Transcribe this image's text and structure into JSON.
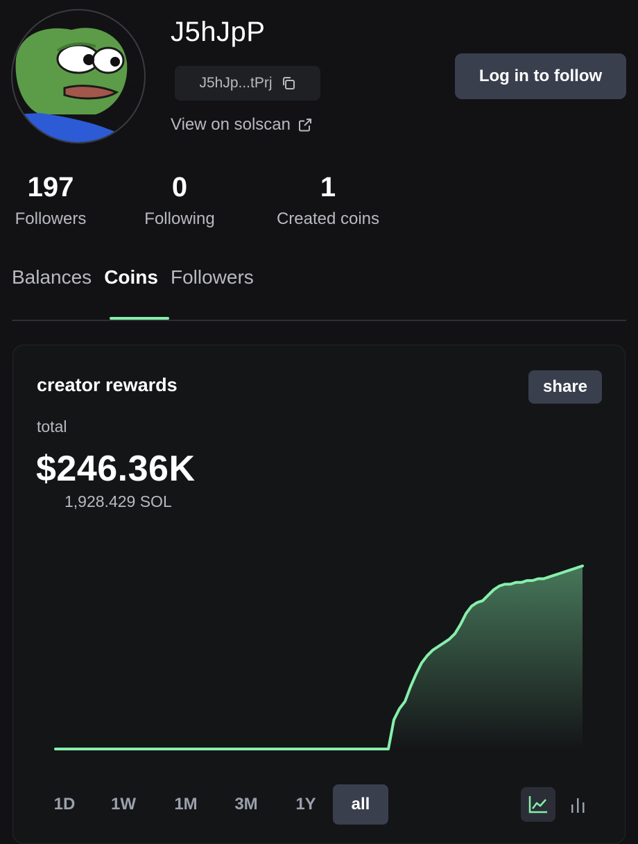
{
  "profile": {
    "username": "J5hJpP",
    "address_short": "J5hJp...tPrj",
    "solscan_label": "View on solscan",
    "follow_label": "Log in to follow"
  },
  "stats": [
    {
      "value": "197",
      "label": "Followers"
    },
    {
      "value": "0",
      "label": "Following"
    },
    {
      "value": "1",
      "label": "Created coins"
    }
  ],
  "tabs": [
    {
      "label": "Balances",
      "active": false
    },
    {
      "label": "Coins",
      "active": true
    },
    {
      "label": "Followers",
      "active": false
    }
  ],
  "card": {
    "title": "creator rewards",
    "share_label": "share",
    "total_label": "total",
    "total_value": "$246.36K",
    "total_sol": "1,928.429 SOL"
  },
  "ranges": [
    {
      "label": "1D",
      "active": false
    },
    {
      "label": "1W",
      "active": false
    },
    {
      "label": "1M",
      "active": false
    },
    {
      "label": "3M",
      "active": false
    },
    {
      "label": "1Y",
      "active": false
    },
    {
      "label": "all",
      "active": true
    }
  ],
  "view_toggle": [
    "line-chart-icon",
    "bar-chart-icon"
  ],
  "colors": {
    "background": "#121214",
    "accent_green": "#86efac",
    "button_bg": "#3a3f4e",
    "muted_text": "#b8bac0"
  },
  "chart_data": {
    "type": "area",
    "title": "creator rewards",
    "xlabel": "",
    "ylabel": "",
    "grid": false,
    "y_relative": [
      0.0,
      0.0,
      0.0,
      0.0,
      0.0,
      0.0,
      0.0,
      0.0,
      0.0,
      0.0,
      0.0,
      0.0,
      0.0,
      0.0,
      0.0,
      0.0,
      0.0,
      0.0,
      0.0,
      0.0,
      0.0,
      0.0,
      0.0,
      0.0,
      0.0,
      0.0,
      0.0,
      0.0,
      0.0,
      0.0,
      0.0,
      0.0,
      0.0,
      0.0,
      0.0,
      0.0,
      0.0,
      0.0,
      0.0,
      0.0,
      0.0,
      0.0,
      0.0,
      0.0,
      0.0,
      0.0,
      0.0,
      0.0,
      0.0,
      0.0,
      0.0,
      0.0,
      0.0,
      0.0,
      0.0,
      0.0,
      0.0,
      0.0,
      0.0,
      0.0,
      0.0,
      0.16,
      0.22,
      0.26,
      0.34,
      0.41,
      0.47,
      0.51,
      0.54,
      0.56,
      0.58,
      0.6,
      0.63,
      0.68,
      0.74,
      0.78,
      0.8,
      0.81,
      0.84,
      0.87,
      0.89,
      0.9,
      0.9,
      0.91,
      0.91,
      0.92,
      0.92,
      0.93,
      0.93,
      0.94,
      0.95,
      0.96,
      0.97,
      0.98,
      0.99,
      1.0
    ]
  }
}
